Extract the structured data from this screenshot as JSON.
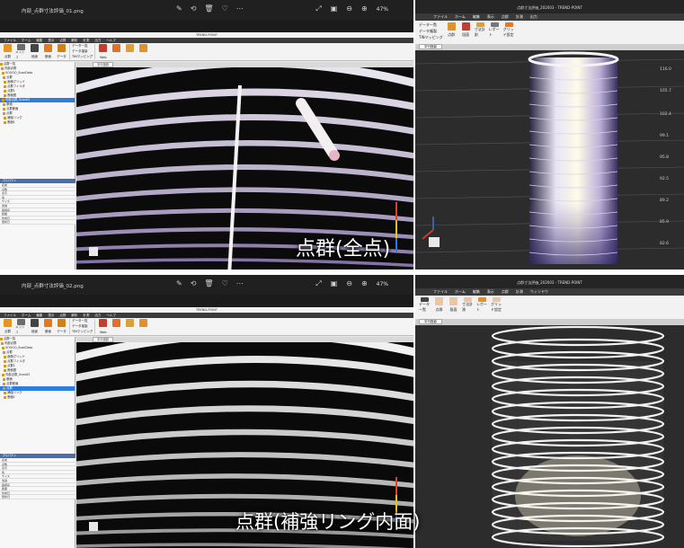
{
  "viewer_top": {
    "filename": "内部_点群寸法評価_01.png",
    "zoom": "47%"
  },
  "viewer_bottom": {
    "filename": "内部_点群寸法評価_02.png",
    "zoom": "47%"
  },
  "app": {
    "title": "TREND-POINT",
    "menus": [
      "ファイル",
      "ホーム",
      "編集",
      "表示",
      "点群",
      "解析",
      "計測",
      "出力",
      "ヘルプ"
    ],
    "ribbon_buttons": [
      "点群",
      "メッシュ",
      "段面",
      "断面",
      "データ",
      "Web"
    ],
    "ribbon_group_items": [
      "データ一覧",
      "データ複製",
      "TINマッピング"
    ],
    "tree_items": [
      "点群一覧",
      "内部点群",
      "SOOOO_ScanData",
      "点群",
      "面積グリッド",
      "点群フィルタ",
      "点群1",
      "断面図",
      "内部点群_Scan03",
      "断面",
      "点群断面",
      "点群",
      "補強リング",
      "断面1"
    ],
    "props_header": "プロパティ",
    "props_rows": [
      "名前",
      "点数",
      "表示",
      "色",
      "サイズ",
      "透過",
      "座標系",
      "範囲",
      "作成日",
      "更新日"
    ],
    "view_tab": "平行投影"
  },
  "right_app": {
    "title": "点群寸法評価_202003 - TREND-POINT",
    "menus": [
      "ファイル",
      "ホーム",
      "編集",
      "表示",
      "点群",
      "計測",
      "出力",
      "ウィンドウ"
    ],
    "ribbon": [
      "データ一覧",
      "データ複製",
      "TINマッピング",
      "点群",
      "段面",
      "寸法計測",
      "レポート",
      "グリッド設定"
    ],
    "view_tab": "平行投影",
    "axis_labels": [
      "116.0",
      "105.7",
      "102.4",
      "99.1",
      "95.8",
      "92.5",
      "89.2",
      "85.9",
      "82.6",
      "79.3"
    ]
  },
  "captions": {
    "top": "点群(全点)",
    "bottom": "点群(補強リング内面)"
  },
  "colors": {
    "viewer_bg": "#202020",
    "selection": "#2f7de1",
    "caption": "#ffffff"
  }
}
